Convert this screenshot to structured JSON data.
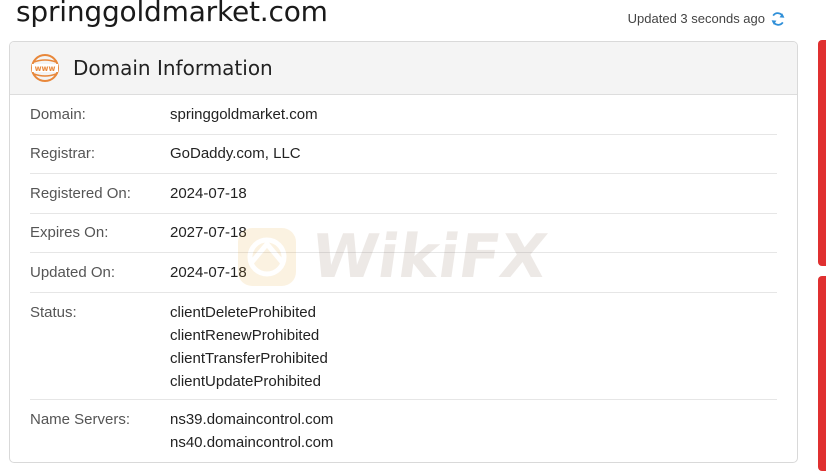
{
  "page": {
    "title": "springgoldmarket.com",
    "updated_text": "Updated 3 seconds ago"
  },
  "panel": {
    "title": "Domain Information",
    "icon": "www-icon"
  },
  "rows": [
    {
      "label": "Domain:",
      "values": [
        "springgoldmarket.com"
      ]
    },
    {
      "label": "Registrar:",
      "values": [
        "GoDaddy.com, LLC"
      ]
    },
    {
      "label": "Registered On:",
      "values": [
        "2024-07-18"
      ]
    },
    {
      "label": "Expires On:",
      "values": [
        "2027-07-18"
      ]
    },
    {
      "label": "Updated On:",
      "values": [
        "2024-07-18"
      ]
    },
    {
      "label": "Status:",
      "values": [
        "clientDeleteProhibited",
        "clientRenewProhibited",
        "clientTransferProhibited",
        "clientUpdateProhibited"
      ]
    },
    {
      "label": "Name Servers:",
      "values": [
        "ns39.domaincontrol.com",
        "ns40.domaincontrol.com"
      ]
    }
  ],
  "watermark": {
    "text": "WikiFX"
  },
  "colors": {
    "accent_blue": "#2f8fd8",
    "www_orange": "#e8873a",
    "side_red": "#e03030"
  }
}
